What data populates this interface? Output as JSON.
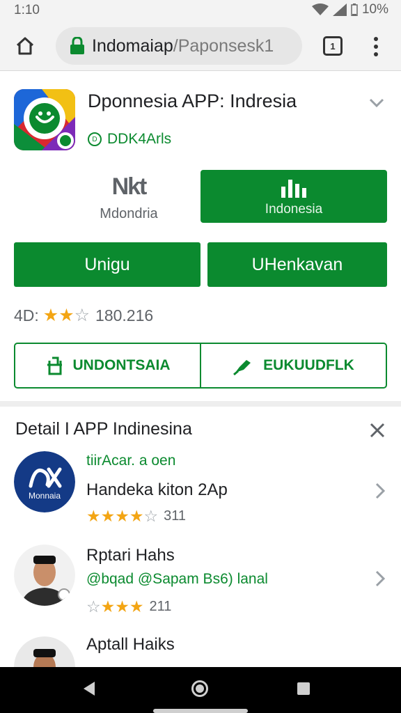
{
  "status_bar": {
    "time": "1:10",
    "battery": "10%",
    "icons": [
      "wifi-icon",
      "signal-icon",
      "battery-icon"
    ]
  },
  "browser": {
    "domain": "Indomaiap",
    "path": "/Paponsesk1",
    "tab_count": "1",
    "icons": [
      "home-icon",
      "lock-icon",
      "tabs-icon",
      "menu-icon"
    ]
  },
  "app": {
    "title": "Dponnesia APP: Indresia",
    "developer": "DDK4Arls",
    "secondary_action": {
      "icon_text": "Nkt",
      "label": "Mdondria"
    },
    "install": {
      "label": "Indonesia"
    },
    "buttons": {
      "left": "Unigu",
      "right": "UHenkavan"
    },
    "rating": {
      "prefix": "4D:",
      "stars_filled": 2.5,
      "stars_total": 5,
      "count": "180.216"
    },
    "outline_buttons": {
      "left": "UNDONTSAIA",
      "right": "EUKUUDFLK"
    }
  },
  "list": {
    "title": "Detail I APP Indinesina",
    "items": [
      {
        "avatar_text": "Monnaia",
        "green": "tiirAcar. a oen",
        "name": "Handeka kiton 2Ap",
        "stars_filled": 3.5,
        "count": "311"
      },
      {
        "name": "Rptari Hahs",
        "green": "@bqad @Sapam Bs6) lanal",
        "stars_filled": 3,
        "count": "211"
      },
      {
        "name": "Aptall Haiks"
      }
    ]
  },
  "colors": {
    "accent": "#0b8a2f",
    "star": "#f3a514",
    "navbar": "#000000"
  }
}
